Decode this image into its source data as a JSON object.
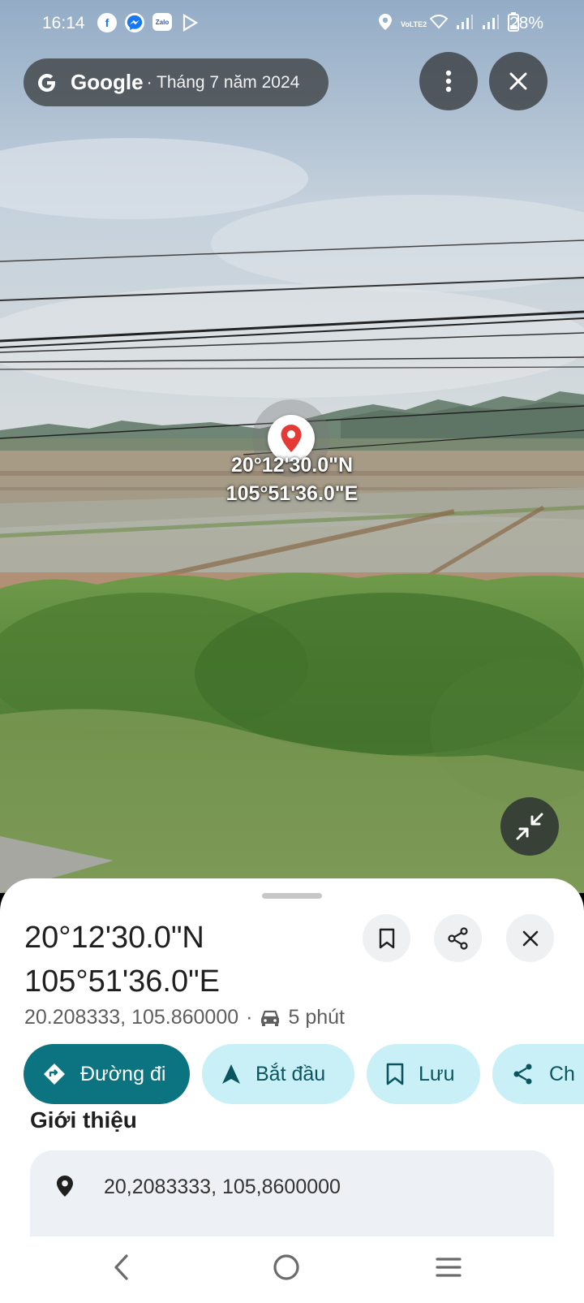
{
  "status_bar": {
    "time": "16:14",
    "network_label": "VoLTE2",
    "battery": "28%",
    "app_icons": [
      "facebook-icon",
      "messenger-icon",
      "zalo-icon",
      "play-icon"
    ],
    "zalo_label": "Zalo"
  },
  "header": {
    "brand": "Google",
    "date": "· Tháng 7 năm 2024"
  },
  "street_view": {
    "lat_dms": "20°12'30.0\"N",
    "lng_dms": "105°51'36.0\"E"
  },
  "place": {
    "title_line1": "20°12'30.0\"N",
    "title_line2": "105°51'36.0\"E",
    "decimal_coords": "20.208333, 105.860000",
    "separator": "·",
    "drive_time": "5 phút"
  },
  "actions": [
    {
      "label": "Đường đi",
      "icon": "directions-icon"
    },
    {
      "label": "Bắt đầu",
      "icon": "navigate-icon"
    },
    {
      "label": "Lưu",
      "icon": "bookmark-icon"
    },
    {
      "label": "Ch",
      "icon": "share-icon"
    }
  ],
  "about": {
    "title": "Giới thiệu",
    "coords": "20,2083333, 105,8600000"
  },
  "colors": {
    "primary": "#0b7480",
    "tonal": "#c9f0f7",
    "pin_red": "#e53935"
  }
}
